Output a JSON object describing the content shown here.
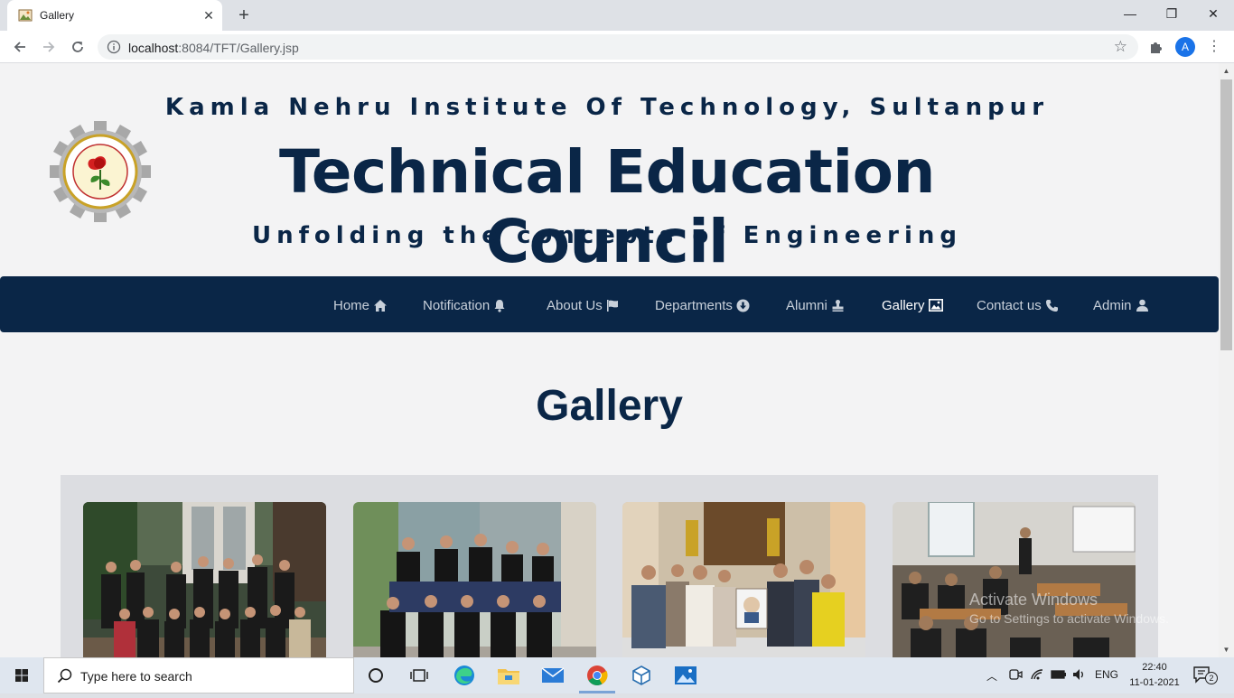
{
  "browser": {
    "tab_title": "Gallery",
    "url_host": "localhost",
    "url_rest": ":8084/TFT/Gallery.jsp",
    "profile_initial": "A"
  },
  "header": {
    "institute": "Kamla Nehru Institute Of Technology, Sultanpur",
    "council": "Technical Education Council",
    "tagline": "Unfolding the concepts of Engineering"
  },
  "nav": {
    "items": [
      {
        "label": "Home",
        "icon": "home-icon"
      },
      {
        "label": "Notification",
        "icon": "bell-icon"
      },
      {
        "label": "About Us",
        "icon": "flag-icon"
      },
      {
        "label": "Departments",
        "icon": "arrow-circle-down-icon"
      },
      {
        "label": "Alumni",
        "icon": "stamp-icon"
      },
      {
        "label": "Gallery",
        "icon": "image-icon"
      },
      {
        "label": "Contact us",
        "icon": "phone-icon"
      },
      {
        "label": "Admin",
        "icon": "user-icon"
      }
    ],
    "active": "Gallery"
  },
  "page": {
    "title": "Gallery"
  },
  "watermark": {
    "line1": "Activate Windows",
    "line2": "Go to Settings to activate Windows."
  },
  "taskbar": {
    "search_placeholder": "Type here to search",
    "language": "ENG",
    "time": "22:40",
    "date": "11-01-2021",
    "notification_count": "2"
  },
  "colors": {
    "brand_navy": "#0a2647",
    "page_bg": "#f3f3f4",
    "gallery_panel": "#dcdde1"
  }
}
